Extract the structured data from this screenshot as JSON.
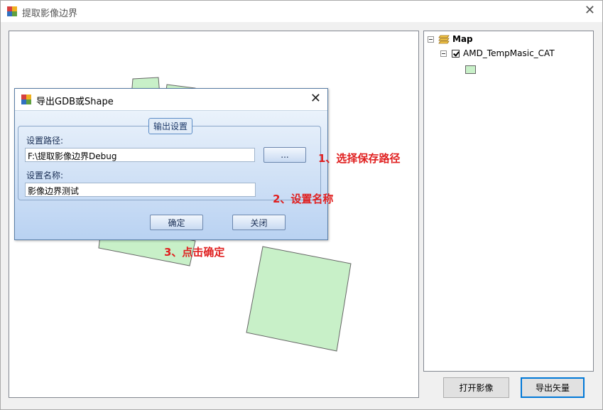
{
  "window": {
    "title": "提取影像边界",
    "close_icon": "close-icon"
  },
  "toc": {
    "root_label": "Map",
    "layer_label": "AMD_TempMasic_CAT",
    "legend_color": "#c8f0c8"
  },
  "buttons": {
    "open_image": "打开影像",
    "export_vector": "导出矢量"
  },
  "dialog": {
    "title": "导出GDB或Shape",
    "group_title": "输出设置",
    "path_label": "设置路径:",
    "path_value": "F:\\提取影像边界Debug",
    "browse_label": "...",
    "name_label": "设置名称:",
    "name_value": "影像边界测试",
    "ok_label": "确定",
    "close_label": "关闭"
  },
  "annotations": {
    "step1": "1、选择保存路径",
    "step2": "2、设置名称",
    "step3": "3、点击确定",
    "color": "#e02020"
  }
}
